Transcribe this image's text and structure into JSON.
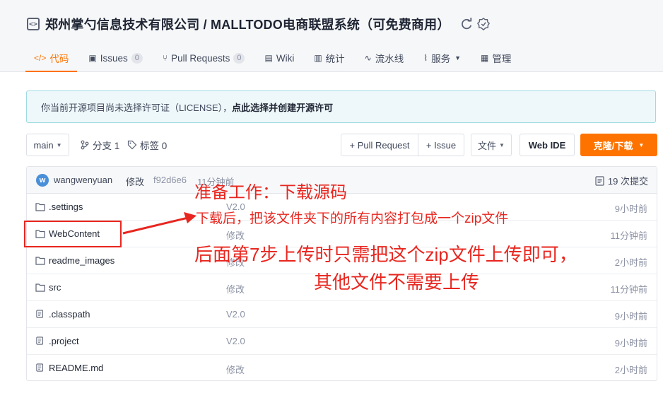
{
  "repo": {
    "title": "郑州掌勺信息技术有限公司 / MALLTODO电商联盟系统（可免费商用）",
    "icon": "repo-code-icon"
  },
  "tabs": [
    {
      "label": "代码",
      "icon": "code-icon",
      "active": true
    },
    {
      "label": "Issues",
      "icon": "issues-icon",
      "count": "0"
    },
    {
      "label": "Pull Requests",
      "icon": "pull-request-icon",
      "count": "0"
    },
    {
      "label": "Wiki",
      "icon": "book-icon"
    },
    {
      "label": "统计",
      "icon": "bar-chart-icon"
    },
    {
      "label": "流水线",
      "icon": "pipeline-icon"
    },
    {
      "label": "服务",
      "icon": "pulse-icon"
    },
    {
      "label": "管理",
      "icon": "settings-doc-icon"
    }
  ],
  "notice": {
    "text": "你当前开源项目尚未选择许可证（LICENSE），",
    "link": "点此选择并创建开源许可"
  },
  "toolbar": {
    "branch": "main",
    "branches": "分支 1",
    "tags": "标签 0",
    "pull_request": "+ Pull Request",
    "issue": "+ Issue",
    "file": "文件",
    "web_ide": "Web IDE",
    "clone": "克隆/下载"
  },
  "commit": {
    "avatar_letter": "w",
    "author": "wangwenyuan",
    "message": "修改",
    "hash": "f92d6e6",
    "time": "11分钟前",
    "count": "19 次提交"
  },
  "files": [
    {
      "name": ".settings",
      "type": "folder",
      "message": "V2.0",
      "time": "9小时前"
    },
    {
      "name": "WebContent",
      "type": "folder",
      "message": "修改",
      "time": "11分钟前"
    },
    {
      "name": "readme_images",
      "type": "folder",
      "message": "修改",
      "time": "2小时前"
    },
    {
      "name": "src",
      "type": "folder",
      "message": "修改",
      "time": "11分钟前"
    },
    {
      "name": ".classpath",
      "type": "file",
      "message": "V2.0",
      "time": "9小时前"
    },
    {
      "name": ".project",
      "type": "file",
      "message": "V2.0",
      "time": "9小时前"
    },
    {
      "name": "README.md",
      "type": "file",
      "message": "修改",
      "time": "2小时前"
    }
  ],
  "annotation": {
    "line1": "准备工作：下载源码",
    "line2": "下载后，把该文件夹下的所有内容打包成一个zip文件",
    "line3": "后面第7步上传时只需把这个zip文件上传即可，",
    "line4": "其他文件不需要上传",
    "color": "#e8261f"
  },
  "colors": {
    "accent": "#fe7300",
    "notice_bg": "#eef8fa",
    "notice_border": "#9fd9e2"
  }
}
